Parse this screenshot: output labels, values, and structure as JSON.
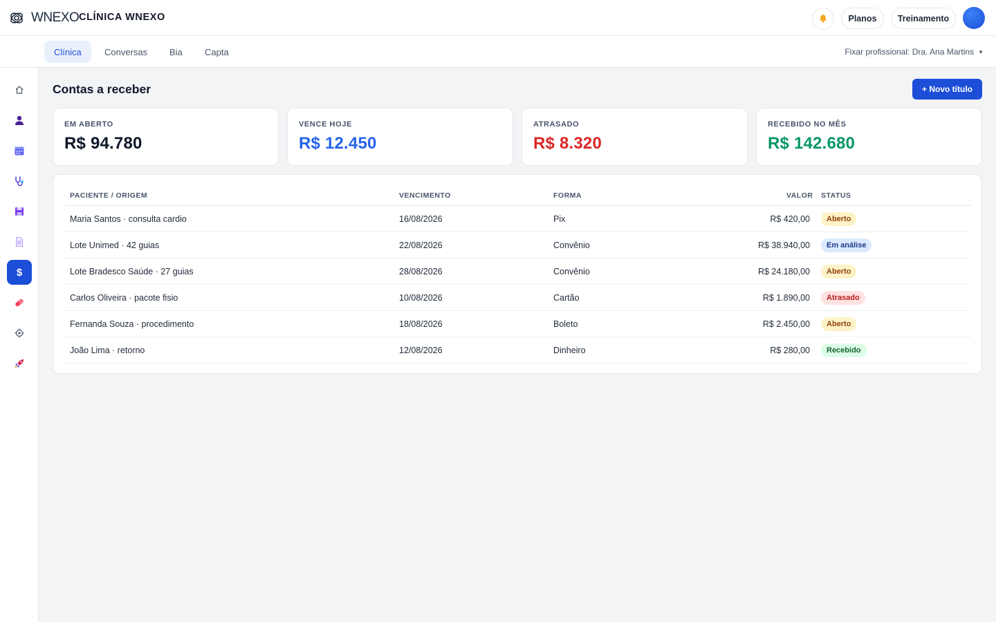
{
  "header": {
    "logo_text": "WNEXO",
    "clinic_name": "CLÍNICA WNEXO",
    "planos_label": "Planos",
    "treinamento_label": "Treinamento"
  },
  "tabs": [
    {
      "label": "Clínica",
      "active": true
    },
    {
      "label": "Conversas",
      "active": false
    },
    {
      "label": "Bia",
      "active": false
    },
    {
      "label": "Capta",
      "active": false
    }
  ],
  "fix_professional": "Fixar profissional: Dra. Ana Martins",
  "sidebar": {
    "items": [
      {
        "icon": "home-icon"
      },
      {
        "icon": "patient-icon"
      },
      {
        "icon": "calendar-icon"
      },
      {
        "icon": "stethoscope-icon"
      },
      {
        "icon": "save-icon"
      },
      {
        "icon": "document-icon"
      },
      {
        "icon": "dollar-icon",
        "glyph": "$",
        "active": true
      },
      {
        "icon": "pill-icon"
      },
      {
        "icon": "settings-icon"
      },
      {
        "icon": "rocket-icon"
      }
    ]
  },
  "page": {
    "title": "Contas a receber",
    "new_button": "+ Novo título"
  },
  "summary_cards": [
    {
      "label": "EM ABERTO",
      "value": "R$ 94.780",
      "color": "#0f172a"
    },
    {
      "label": "VENCE HOJE",
      "value": "R$ 12.450",
      "color": "#2563eb"
    },
    {
      "label": "ATRASADO",
      "value": "R$ 8.320",
      "color": "#dc2626"
    },
    {
      "label": "RECEBIDO NO MÊS",
      "value": "R$ 142.680",
      "color": "#059669"
    }
  ],
  "table": {
    "headers": {
      "patient": "PACIENTE / ORIGEM",
      "due": "VENCIMENTO",
      "method": "FORMA",
      "value": "VALOR",
      "status": "STATUS"
    },
    "rows": [
      {
        "patient": "Maria Santos · consulta cardio",
        "due": "16/08/2026",
        "method": "Pix",
        "value": "R$ 420,00",
        "status": "Aberto",
        "status_bg": "#fdf3c7",
        "status_fg": "#92400e"
      },
      {
        "patient": "Lote Unimed · 42 guias",
        "due": "22/08/2026",
        "method": "Convênio",
        "value": "R$ 38.940,00",
        "status": "Em análise",
        "status_bg": "#dbeafe",
        "status_fg": "#1e3a8a"
      },
      {
        "patient": "Lote Bradesco Saúde · 27 guias",
        "due": "28/08/2026",
        "method": "Convênio",
        "value": "R$ 24.180,00",
        "status": "Aberto",
        "status_bg": "#fdf3c7",
        "status_fg": "#92400e"
      },
      {
        "patient": "Carlos Oliveira · pacote fisio",
        "due": "10/08/2026",
        "method": "Cartão",
        "value": "R$ 1.890,00",
        "status": "Atrasado",
        "status_bg": "#fee2e2",
        "status_fg": "#b91c1c"
      },
      {
        "patient": "Fernanda Souza · procedimento",
        "due": "18/08/2026",
        "method": "Boleto",
        "value": "R$ 2.450,00",
        "status": "Aberto",
        "status_bg": "#fdf3c7",
        "status_fg": "#92400e"
      },
      {
        "patient": "João Lima · retorno",
        "due": "12/08/2026",
        "method": "Dinheiro",
        "value": "R$ 280,00",
        "status": "Recebido",
        "status_bg": "#dcfce7",
        "status_fg": "#166534"
      }
    ]
  }
}
